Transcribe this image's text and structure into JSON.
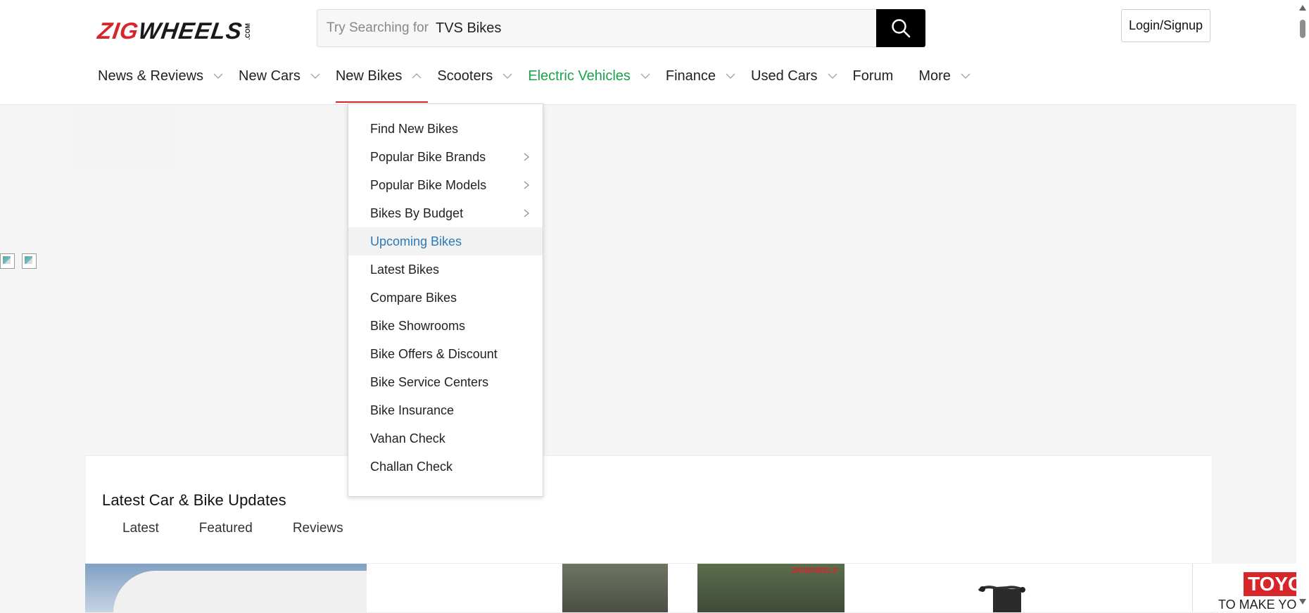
{
  "logo": {
    "zig": "ZIG",
    "wheels": "WHEELS",
    "com": ".COM"
  },
  "search": {
    "label": "Try Searching for",
    "value": "TVS Bikes"
  },
  "login": {
    "label": "Login/Signup"
  },
  "nav": {
    "items": [
      {
        "label": "News & Reviews"
      },
      {
        "label": "New Cars"
      },
      {
        "label": "New Bikes"
      },
      {
        "label": "Scooters"
      },
      {
        "label": "Electric Vehicles"
      },
      {
        "label": "Finance"
      },
      {
        "label": "Used Cars"
      },
      {
        "label": "Forum"
      },
      {
        "label": "More"
      }
    ]
  },
  "dropdown": {
    "items": [
      {
        "label": "Find New Bikes"
      },
      {
        "label": "Popular Bike Brands"
      },
      {
        "label": "Popular Bike Models"
      },
      {
        "label": "Bikes By Budget"
      },
      {
        "label": "Upcoming Bikes"
      },
      {
        "label": "Latest Bikes"
      },
      {
        "label": "Compare Bikes"
      },
      {
        "label": "Bike Showrooms"
      },
      {
        "label": "Bike Offers & Discount"
      },
      {
        "label": "Bike Service Centers"
      },
      {
        "label": "Bike Insurance"
      },
      {
        "label": "Vahan Check"
      },
      {
        "label": "Challan Check"
      }
    ]
  },
  "updates": {
    "title": "Latest Car & Bike Updates",
    "tabs": [
      {
        "label": "Latest"
      },
      {
        "label": "Featured"
      },
      {
        "label": "Reviews"
      }
    ]
  },
  "thumb_watermark": "ZIGWHEELS",
  "ad": {
    "brand": "TOYO",
    "text": "TO MAKE YOU"
  },
  "colors": {
    "brand_red": "#d7262a",
    "ev_green": "#1aa34a",
    "link_blue": "#2a7ab7"
  }
}
